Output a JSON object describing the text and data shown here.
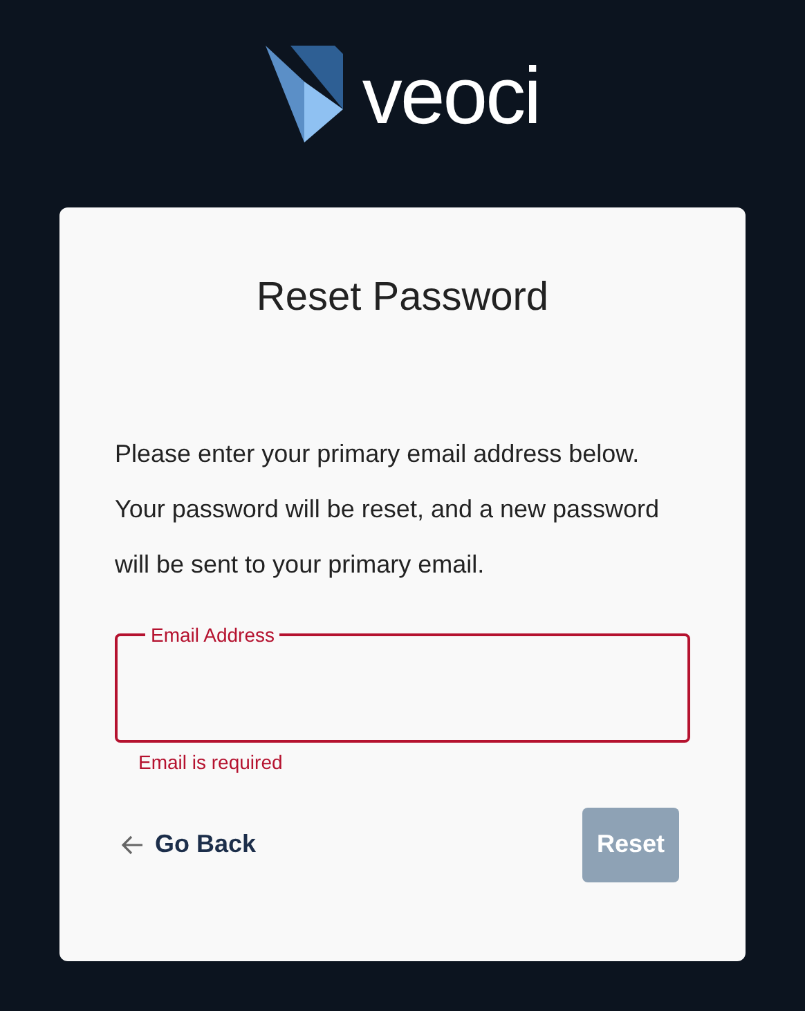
{
  "logo": {
    "text": "veoci"
  },
  "card": {
    "title": "Reset Password",
    "description": "Please enter your primary email address below. Your password will be reset, and a new password will be sent to your primary email.",
    "email_field": {
      "label": "Email Address",
      "invalid": true,
      "error": "Email is required"
    },
    "go_back": {
      "label": "Go Back"
    },
    "reset_button": {
      "label": "Reset",
      "disabled": true
    }
  }
}
